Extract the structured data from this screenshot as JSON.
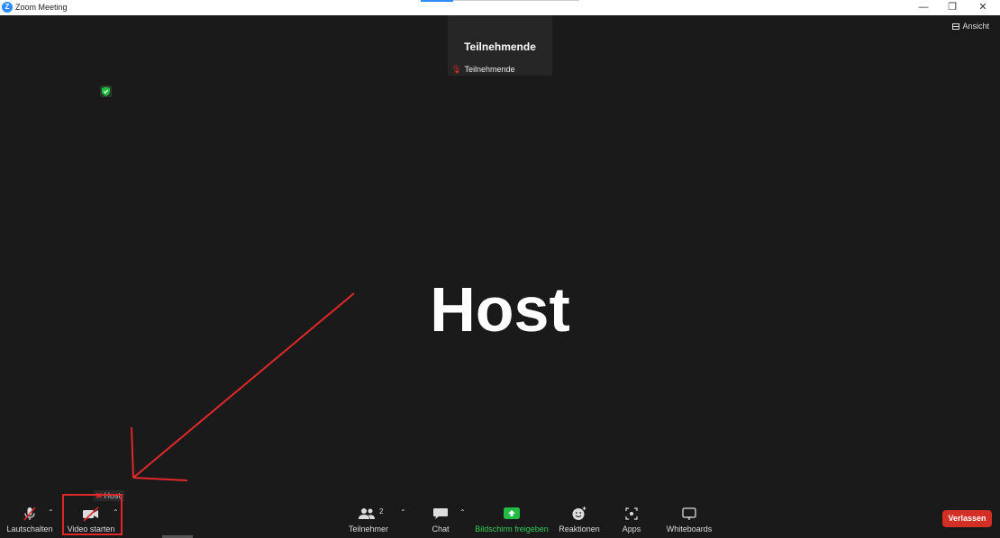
{
  "window": {
    "title": "Zoom Meeting",
    "app_icon_letter": "Z",
    "minimize_icon": "minimize-icon",
    "restore_icon": "restore-icon",
    "close_icon": "close-icon"
  },
  "view_button": {
    "label": "Ansicht",
    "icon": "grid-view-icon"
  },
  "participant_tile": {
    "display_name": "Teilnehmende",
    "label": "Teilnehmende",
    "mic_icon": "muted-mic-icon"
  },
  "security_icon": "shield-icon",
  "active_speaker": {
    "name": "Host"
  },
  "small_label": {
    "text": "Host"
  },
  "toolbar": {
    "unmute": {
      "label": "Lautschalten",
      "icon": "muted-mic-icon"
    },
    "video": {
      "label": "Video starten",
      "icon": "video-off-icon"
    },
    "participants": {
      "label": "Teilnehmer",
      "count": "2",
      "icon": "participants-icon"
    },
    "chat": {
      "label": "Chat",
      "icon": "chat-icon"
    },
    "share": {
      "label": "Bildschirm freigeben",
      "icon": "share-screen-icon"
    },
    "reactions": {
      "label": "Reaktionen",
      "icon": "smiley-icon"
    },
    "apps": {
      "label": "Apps",
      "icon": "apps-icon"
    },
    "whiteboards": {
      "label": "Whiteboards",
      "icon": "whiteboard-icon"
    },
    "leave": {
      "label": "Verlassen"
    }
  },
  "colors": {
    "background": "#1a1a1a",
    "accent": "#2d8cff",
    "leave": "#d22f27",
    "share_green": "#33cc55",
    "annotation_red": "#e02828"
  }
}
